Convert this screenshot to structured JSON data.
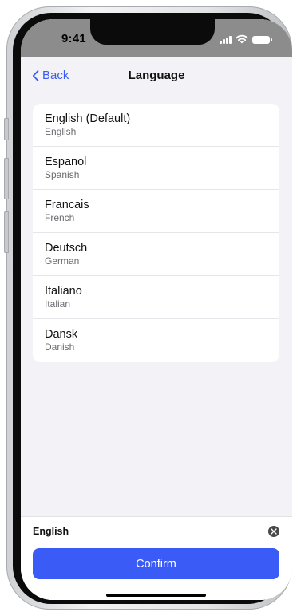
{
  "status_bar": {
    "time": "9:41"
  },
  "nav": {
    "back_label": "Back",
    "title": "Language"
  },
  "languages": [
    {
      "name": "English (Default)",
      "subtitle": "English"
    },
    {
      "name": "Espanol",
      "subtitle": "Spanish"
    },
    {
      "name": "Francais",
      "subtitle": "French"
    },
    {
      "name": "Deutsch",
      "subtitle": "German"
    },
    {
      "name": "Italiano",
      "subtitle": "Italian"
    },
    {
      "name": "Dansk",
      "subtitle": "Danish"
    }
  ],
  "footer": {
    "selected": "English",
    "confirm_label": "Confirm"
  },
  "icons": {
    "back": "chevron-left-icon",
    "clear": "close-circle-icon",
    "signal": "cellular-signal-icon",
    "wifi": "wifi-icon",
    "battery": "battery-icon"
  },
  "colors": {
    "accent": "#3b5bf6",
    "background": "#f2f2f7",
    "status_bar": "#8c8c8c"
  }
}
